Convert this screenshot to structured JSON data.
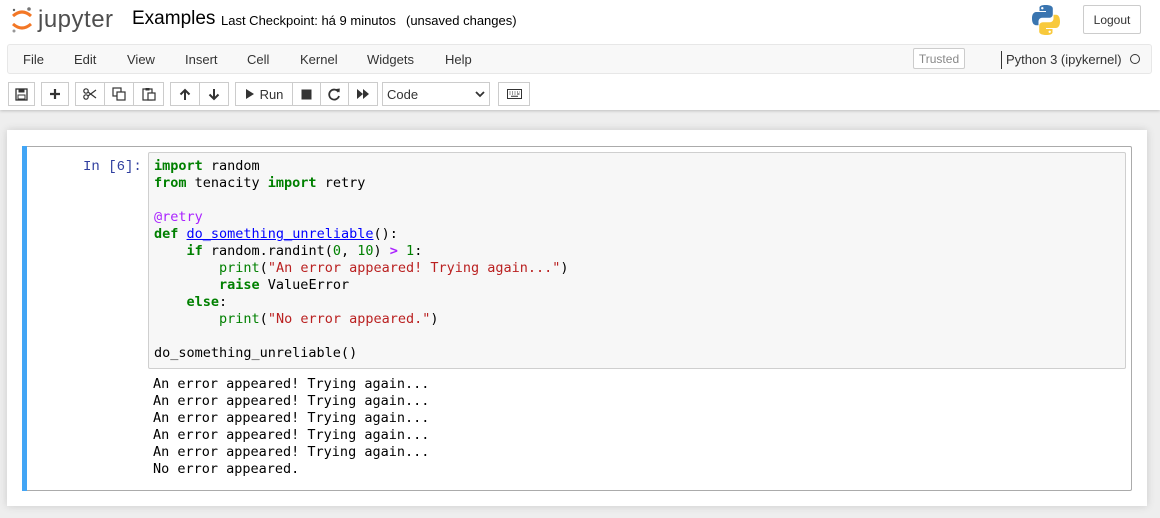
{
  "header": {
    "logo_text": "jupyter",
    "notebook_name": "Examples",
    "checkpoint": "Last Checkpoint: há 9 minutos",
    "unsaved": "(unsaved changes)",
    "logout_label": "Logout"
  },
  "menubar": {
    "items": [
      "File",
      "Edit",
      "View",
      "Insert",
      "Cell",
      "Kernel",
      "Widgets",
      "Help"
    ],
    "trusted": "Trusted",
    "kernel_name": "Python 3 (ipykernel)"
  },
  "toolbar": {
    "run_label": "Run",
    "cell_type": "Code",
    "buttons": [
      "save-icon",
      "plus-icon",
      "cut-icon",
      "copy-icon",
      "paste-icon",
      "arrow-up-icon",
      "arrow-down-icon",
      "run-icon",
      "stop-icon",
      "restart-icon",
      "fast-forward-icon",
      "keyboard-icon"
    ]
  },
  "cell": {
    "prompt": "In [6]:",
    "code": {
      "l1_kw": "import",
      "l1_rest": " random",
      "l2_kw1": "from",
      "l2_mid": " tenacity ",
      "l2_kw2": "import",
      "l2_rest": " retry",
      "l4_dec": "@retry",
      "l5_kw": "def",
      "l5_fn": "do_something_unreliable",
      "l5_rest": "():",
      "l6_indent": "    ",
      "l6_kw": "if",
      "l6_a": " random.randint(",
      "l6_n1": "0",
      "l6_b": ", ",
      "l6_n2": "10",
      "l6_c": ") ",
      "l6_op": ">",
      "l6_d": " ",
      "l6_n3": "1",
      "l6_e": ":",
      "l7_indent": "        ",
      "l7_bi": "print",
      "l7_a": "(",
      "l7_str": "\"An error appeared! Trying again...\"",
      "l7_b": ")",
      "l8_indent": "        ",
      "l8_kw": "raise",
      "l8_rest": " ValueError",
      "l9_indent": "    ",
      "l9_kw": "else",
      "l9_rest": ":",
      "l10_indent": "        ",
      "l10_bi": "print",
      "l10_a": "(",
      "l10_str": "\"No error appeared.\"",
      "l10_b": ")",
      "l12": "do_something_unreliable()"
    },
    "output": [
      "An error appeared! Trying again...",
      "An error appeared! Trying again...",
      "An error appeared! Trying again...",
      "An error appeared! Trying again...",
      "An error appeared! Trying again...",
      "No error appeared."
    ]
  },
  "colors": {
    "accent_blue": "#42a5f5",
    "prompt_blue": "#303f9f",
    "keyword_green": "#008000",
    "string_red": "#ba2121",
    "decorator_purple": "#aa22ff",
    "logo_orange": "#f37726"
  }
}
